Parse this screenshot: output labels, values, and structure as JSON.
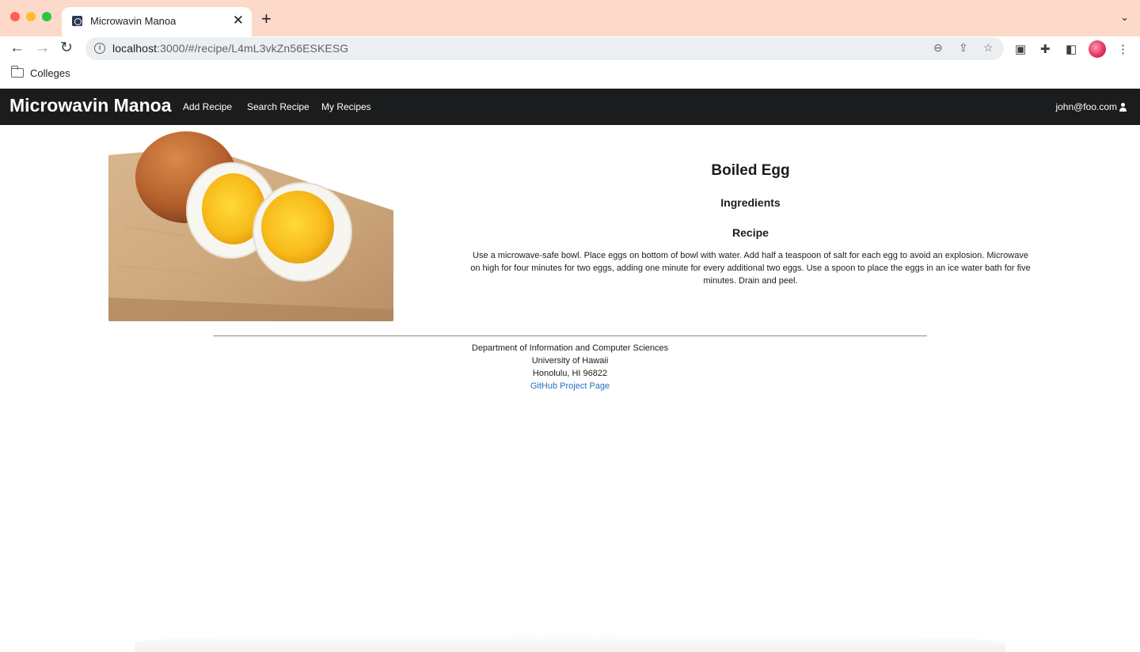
{
  "browser": {
    "tab_title": "Microwavin Manoa",
    "tab_close": "✕",
    "new_tab": "+",
    "tab_menu": "⌄",
    "url_host": "localhost",
    "url_rest": ":3000/#/recipe/L4mL3vkZn56ESKESG",
    "bookmarks": [
      {
        "label": "Colleges",
        "icon": "folder-icon"
      }
    ],
    "icons": [
      "back-icon",
      "forward-icon",
      "reload-icon",
      "info-icon",
      "zoom-icon",
      "share-icon",
      "star-icon",
      "extension-icon",
      "puzzle-icon",
      "sidepanel-icon",
      "profile-avatar",
      "menu-icon"
    ]
  },
  "navbar": {
    "brand": "Microwavin Manoa",
    "links": [
      "Add Recipe",
      "Search Recipe",
      "My Recipes"
    ],
    "user": "john@foo.com",
    "user_icon": "user-icon"
  },
  "recipe": {
    "title": "Boiled Egg",
    "ingredients_heading": "Ingredients",
    "recipe_heading": "Recipe",
    "instructions": "Use a microwave-safe bowl. Place eggs on bottom of bowl with water. Add half a teaspoon of salt for each egg to avoid an explosion. Microwave on high for four minutes for two eggs, adding one minute for every additional two eggs. Use a spoon to place the eggs in an ice water bath for five minutes. Drain and peel."
  },
  "footer": {
    "line1": "Department of Information and Computer Sciences",
    "line2": "University of Hawaii",
    "line3": "Honolulu, HI 96822",
    "link": "GitHub Project Page"
  },
  "colors": {
    "navbar_bg": "#1b1c1d",
    "tabbar_bg": "#fcd9c8",
    "link": "#1e70bf"
  }
}
